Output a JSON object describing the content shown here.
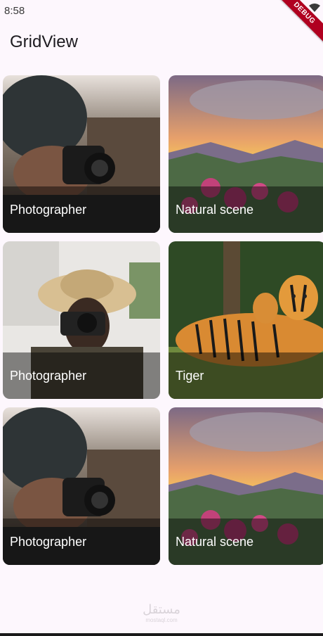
{
  "status_bar": {
    "time": "8:58"
  },
  "debug_banner": {
    "label": "DEBUG"
  },
  "app_bar": {
    "title": "GridView"
  },
  "grid": {
    "items": [
      {
        "caption": "Photographer",
        "image": "photographer-beanie"
      },
      {
        "caption": "Natural scene",
        "image": "mountain-sunset"
      },
      {
        "caption": "Photographer",
        "image": "photographer-sunhat"
      },
      {
        "caption": "Tiger",
        "image": "tigers"
      },
      {
        "caption": "Photographer",
        "image": "photographer-beanie"
      },
      {
        "caption": "Natural scene",
        "image": "mountain-sunset"
      }
    ]
  },
  "watermark": {
    "text": "مستقل",
    "subtext": "mostaql.com"
  }
}
